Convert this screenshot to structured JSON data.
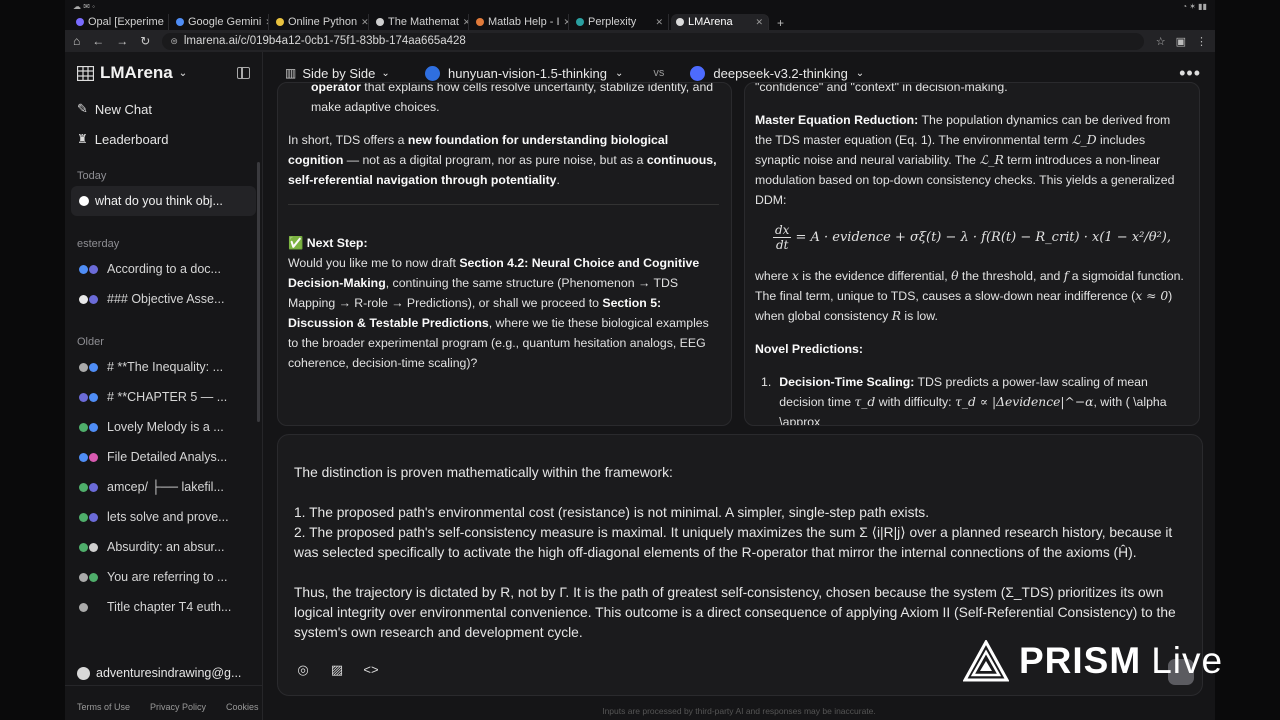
{
  "browser": {
    "tabs": [
      {
        "label": "Opal [Experime",
        "active": false
      },
      {
        "label": "Google Gemini",
        "active": false
      },
      {
        "label": "Online Python",
        "active": false
      },
      {
        "label": "The Mathemat",
        "active": false
      },
      {
        "label": "Matlab Help - I",
        "active": false
      },
      {
        "label": "Perplexity",
        "active": false
      },
      {
        "label": "LMArena",
        "active": true
      }
    ],
    "url": "lmarena.ai/c/019b4a12-0cb1-75f1-83bb-174aa665a428"
  },
  "sidebar": {
    "brand": "LMArena",
    "new_chat": "New Chat",
    "leaderboard": "Leaderboard",
    "today_label": "Today",
    "today_items": [
      {
        "label": "what do you think obj..."
      }
    ],
    "yesterday_label": "esterday",
    "yesterday_items": [
      {
        "label": "According to a doc..."
      },
      {
        "label": "### Objective Asse..."
      }
    ],
    "older_label": "Older",
    "older_items": [
      {
        "label": "# **The Inequality: ..."
      },
      {
        "label": "# **CHAPTER 5 — ..."
      },
      {
        "label": "Lovely Melody is a ..."
      },
      {
        "label": "File Detailed Analys..."
      },
      {
        "label": "amcep/ ├── lakefil..."
      },
      {
        "label": "lets solve and prove..."
      },
      {
        "label": "Absurdity: an absur..."
      },
      {
        "label": "You are referring to ..."
      },
      {
        "label": "Title chapter T4 euth..."
      }
    ],
    "user": "adventuresindrawing@g...",
    "footer": {
      "terms": "Terms of Use",
      "privacy": "Privacy Policy",
      "cookies": "Cookies"
    }
  },
  "topbar": {
    "mode": "Side by Side",
    "model_a": "hunyuan-vision-1.5-thinking",
    "vs": "vs",
    "model_b": "deepseek-v3.2-thinking"
  },
  "left_panel": {
    "p1_bold": "operator",
    "p1_rest": " that explains how cells resolve uncertainty, stabilize identity, and make adaptive choices.",
    "p2_a": "In short, TDS offers a ",
    "p2_b1": "new foundation for understanding biological cognition",
    "p2_c": " — not as a digital program, nor as pure noise, but as a ",
    "p2_b2": "continuous, self-referential navigation through potentiality",
    "p2_d": ".",
    "next_step_label": "✅ Next Step:",
    "ns_a": "Would you like me to now draft ",
    "ns_b1": "Section 4.2: Neural Choice and Cognitive Decision-Making",
    "ns_c": ", continuing the same structure (Phenomenon → TDS Mapping → R-role → Predictions), or shall we proceed to ",
    "ns_b2": "Section 5: Discussion & Testable Predictions",
    "ns_d": ", where we tie these biological examples to the broader experimental program (e.g., quantum hesitation analogs, EEG coherence, decision-time scaling)?"
  },
  "right_panel": {
    "p0": "\"confidence\" and \"context\" in decision-making.",
    "mer_label": "Master Equation Reduction:",
    "mer_a": " The population dynamics can be derived from the TDS master equation (Eq. 1). The environmental term ",
    "mer_ld": "ℒ_D",
    "mer_b": " includes synaptic noise and neural variability. The ",
    "mer_lr": "ℒ_R",
    "mer_c": " term introduces a non-linear modulation based on top-down consistency checks. This yields a generalized DDM:",
    "eq_num": "dx",
    "eq_den": "dt",
    "eq_rhs": "= A · evidence + σξ(t) − λ · f(R(t) − R_crit) · x(1 − x²/θ²),",
    "after_a": "where ",
    "after_x": "x",
    "after_b": " is the evidence differential, ",
    "after_theta": "θ",
    "after_c": " the threshold, and ",
    "after_f": "f",
    "after_d": " a sigmoidal function. The final term, unique to TDS, causes a slow-down near indifference (",
    "after_xapprox": "x ≈ 0",
    "after_e": ") when global consistency ",
    "after_R": "R",
    "after_f2": " is low.",
    "novel_label": "Novel Predictions:",
    "li_num": "1.",
    "li_label": "Decision-Time Scaling:",
    "li_a": " TDS predicts a power-law scaling of mean decision time ",
    "li_tau": "τ_d",
    "li_b": " with difficulty: ",
    "li_formula": "τ_d ∝ |Δevidence|^−α",
    "li_c": ", with ( \\alpha \\approx"
  },
  "input": {
    "line1": "The distinction is proven mathematically within the framework:",
    "item1": "1. The proposed path's environmental cost (resistance) is not minimal. A simpler, single-step path exists.",
    "item2": "2. The proposed path's self-consistency measure is maximal. It uniquely maximizes the sum Σ ⟨i|R|j⟩ over a planned research history, because it was selected specifically to activate the high off-diagonal elements of the R-operator that mirror the internal connections of the axioms (Ĥ).",
    "para3": "Thus, the trajectory is dictated by R, not by Γ. It is the path of greatest self-consistency, chosen because the system (Σ_TDS) prioritizes its own logical integrity over environmental convenience. This outcome is a direct consequence of applying Axiom II (Self-Referential Consistency) to the system's own research and development cycle."
  },
  "disclaimer": "Inputs are processed by third-party AI and responses may be inaccurate.",
  "watermark": {
    "brand": "PRISM",
    "live": "Live"
  }
}
